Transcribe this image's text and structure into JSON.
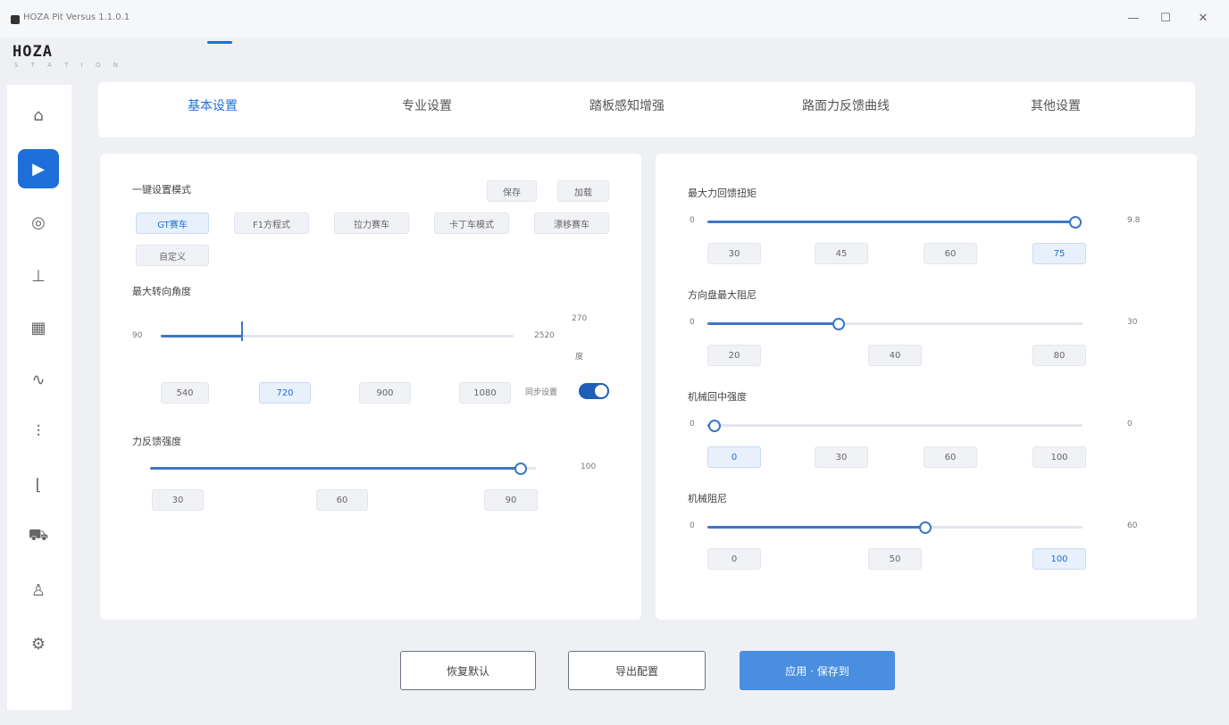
{
  "window": {
    "title": "HOZA Pit Versus 1.1.0.1",
    "logo": "HOZA",
    "logo_sub": "S T A T I O N",
    "min_glyph": "—",
    "max_glyph": "☐",
    "close_glyph": "✕"
  },
  "sidebar": {
    "items": [
      {
        "icon": "home-icon",
        "glyph": "⌂"
      },
      {
        "icon": "wheel-icon",
        "glyph": "▶"
      },
      {
        "icon": "steering-wheel-icon",
        "glyph": "◎"
      },
      {
        "icon": "gear-shift-icon",
        "glyph": "⊥"
      },
      {
        "icon": "display-icon",
        "glyph": "▦"
      },
      {
        "icon": "wave-icon",
        "glyph": "∿"
      },
      {
        "icon": "pedal-icon",
        "glyph": "⫶"
      },
      {
        "icon": "handbrake-icon",
        "glyph": "⌊"
      },
      {
        "icon": "car-icon",
        "glyph": "⛟"
      },
      {
        "icon": "user-icon",
        "glyph": "♙"
      },
      {
        "icon": "tools-icon",
        "glyph": "⚙"
      }
    ]
  },
  "tabs": [
    "基本设置",
    "专业设置",
    "踏板感知增强",
    "路面力反馈曲线",
    "其他设置"
  ],
  "left": {
    "preset_label": "一键设置模式",
    "btn_save": "保存",
    "btn_load": "加载",
    "presets": [
      "GT赛车",
      "F1方程式",
      "拉力赛车",
      "卡丁车模式",
      "漂移赛车",
      "自定义"
    ],
    "rotation_label": "最大转向角度",
    "rotation_min": "90",
    "rotation_max": "2520",
    "rotation_value": 0.23,
    "rotation_unit_top": "270",
    "rotation_unit_bottom": "度",
    "rotation_quick": [
      "540",
      "720",
      "900",
      "1080"
    ],
    "link_label": "同步设置",
    "strength_label": "力反馈强度",
    "strength_value": 0.96,
    "strength_end": "100",
    "strength_quick": [
      "30",
      "60",
      "90"
    ]
  },
  "right": {
    "sliders": [
      {
        "label": "最大力回馈扭矩",
        "value": 0.98,
        "min": "0",
        "value_text": "9.8",
        "quick": [
          "30",
          "45",
          "60",
          "75"
        ]
      },
      {
        "label": "方向盘最大阻尼",
        "value": 0.35,
        "min": "0",
        "value_text": "30",
        "quick": [
          "20",
          "40",
          "80"
        ]
      },
      {
        "label": "机械回中强度",
        "value": 0.02,
        "min": "0",
        "value_text": "0",
        "quick": [
          "0",
          "30",
          "60",
          "100"
        ]
      },
      {
        "label": "机械阻尼",
        "value": 0.58,
        "min": "0",
        "value_text": "60",
        "quick": [
          "0",
          "50",
          "100"
        ]
      }
    ]
  },
  "footer": {
    "btn_reset": "恢复默认",
    "btn_import": "导出配置",
    "btn_apply": "应用 · 保存到"
  }
}
